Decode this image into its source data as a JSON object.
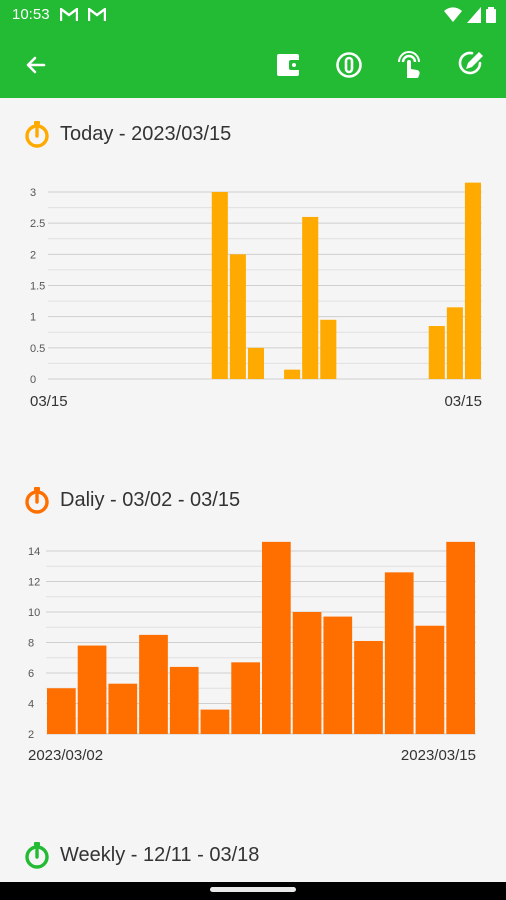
{
  "status_bar": {
    "time": "10:53"
  },
  "colors": {
    "primary": "#22bb33",
    "today_bar": "#ffaa00",
    "daily_bar": "#ff6f00",
    "weekly_icon": "#22bb33"
  },
  "toolbar": {
    "icons": [
      "back-arrow-icon",
      "wallet-icon",
      "counter-icon",
      "touch-icon",
      "edit-icon"
    ]
  },
  "sections": {
    "today": {
      "title": "Today - 2023/03/15"
    },
    "daily": {
      "title": "Daliy - 03/02 - 03/15"
    },
    "weekly": {
      "title": "Weekly - 12/11 - 03/18"
    }
  },
  "chart_data": [
    {
      "type": "bar",
      "title": "Today - 2023/03/15",
      "x_labels": [
        "03/15",
        "03/15"
      ],
      "y_ticks": [
        "0",
        "0.5",
        "1",
        "1.5",
        "2",
        "2.5",
        "3"
      ],
      "ylim": [
        0,
        3
      ],
      "slots": 24,
      "values": [
        0,
        0,
        0,
        0,
        0,
        0,
        0,
        0,
        0,
        3.0,
        2.0,
        0.5,
        0,
        0.15,
        2.6,
        0.95,
        0,
        0,
        0,
        0,
        0,
        0.85,
        1.15,
        3.15
      ],
      "grid": true,
      "color": "#ffaa00"
    },
    {
      "type": "bar",
      "title": "Daliy - 03/02 - 03/15",
      "x_labels": [
        "2023/03/02",
        "2023/03/15"
      ],
      "y_ticks": [
        "2",
        "4",
        "6",
        "8",
        "10",
        "12",
        "14"
      ],
      "ylim": [
        2,
        14
      ],
      "slots": 14,
      "values": [
        5.0,
        7.8,
        5.3,
        8.5,
        6.4,
        3.6,
        6.7,
        15.2,
        10.0,
        9.7,
        8.1,
        12.6,
        9.1,
        14.6
      ],
      "grid": true,
      "color": "#ff6f00"
    }
  ]
}
